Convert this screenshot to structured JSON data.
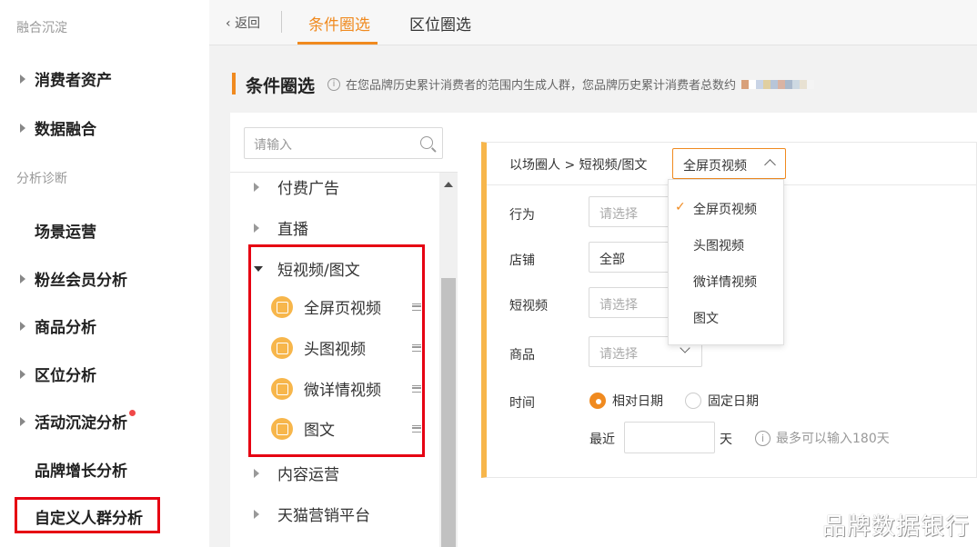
{
  "leftnav": {
    "group1": "融合沉淀",
    "group2": "分析诊断",
    "items": [
      {
        "label": "消费者资产"
      },
      {
        "label": "数据融合"
      },
      {
        "label": "场景运营"
      },
      {
        "label": "粉丝会员分析"
      },
      {
        "label": "商品分析"
      },
      {
        "label": "区位分析"
      },
      {
        "label": "活动沉淀分析"
      },
      {
        "label": "品牌增长分析"
      },
      {
        "label": "自定义人群分析"
      }
    ]
  },
  "topbar": {
    "back": "返回",
    "tabs": [
      {
        "label": "条件圈选"
      },
      {
        "label": "区位圈选"
      }
    ]
  },
  "title": {
    "text": "条件圈选",
    "info": "在您品牌历史累计消费者的范围内生成人群，您品牌历史累计消费者总数约"
  },
  "tree": {
    "search_placeholder": "请输入",
    "nodes": [
      {
        "label": "付费广告"
      },
      {
        "label": "直播"
      },
      {
        "label": "短视频/图文"
      },
      {
        "label": "全屏页视频"
      },
      {
        "label": "头图视频"
      },
      {
        "label": "微详情视频"
      },
      {
        "label": "图文"
      },
      {
        "label": "内容运营"
      },
      {
        "label": "天猫营销平台"
      }
    ]
  },
  "condition": {
    "crumb": "以场圈人 > 短视频/图文",
    "selected": "全屏页视频",
    "rows": {
      "behavior": {
        "label": "行为",
        "value": "请选择"
      },
      "store": {
        "label": "店铺",
        "value": "全部"
      },
      "video": {
        "label": "短视频",
        "value": "请选择"
      },
      "product": {
        "label": "商品",
        "value": "请选择"
      },
      "time": {
        "label": "时间"
      }
    },
    "radio_relative": "相对日期",
    "radio_fixed": "固定日期",
    "recent": "最近",
    "day_unit": "天",
    "hint": "最多可以输入180天"
  },
  "dropdown": {
    "options": [
      "全屏页视频",
      "头图视频",
      "微详情视频",
      "图文"
    ]
  },
  "watermark": "品牌数据银行",
  "colors": {
    "accent": "#f08a1f",
    "highlight": "#e60012",
    "leaf_icon": "#f7b64b"
  }
}
